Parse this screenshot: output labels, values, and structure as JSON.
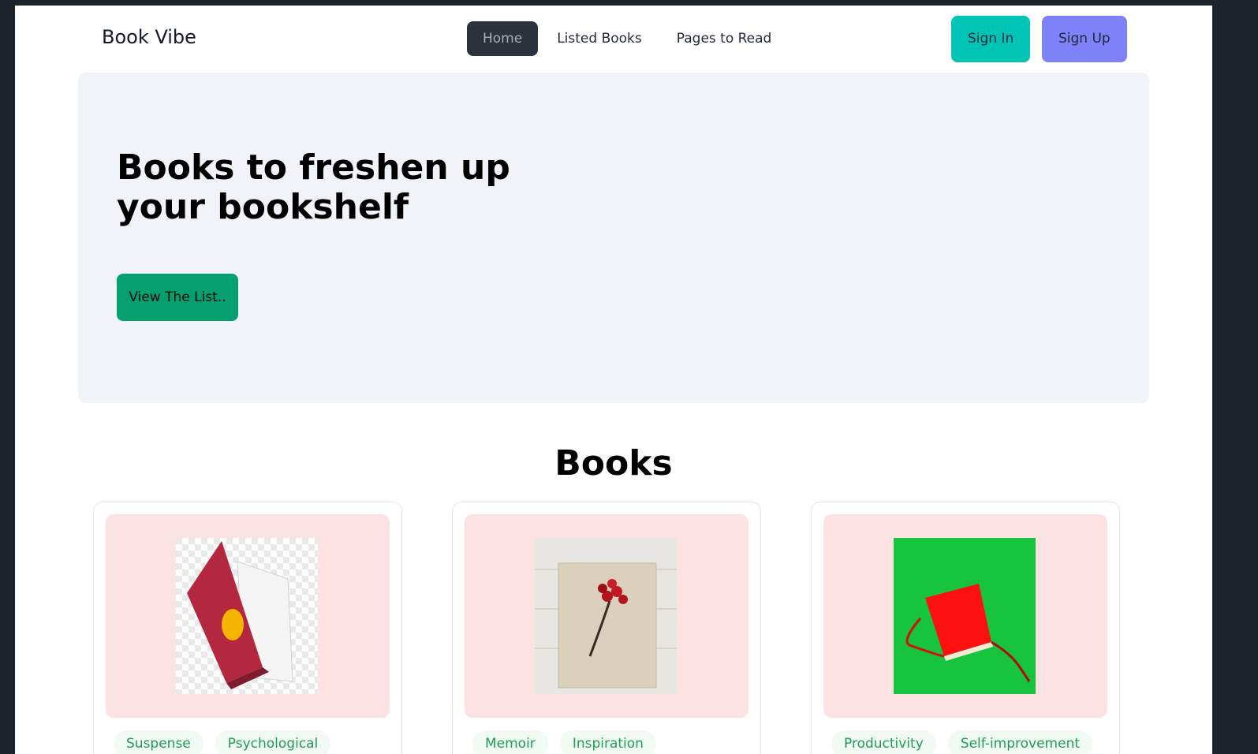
{
  "navbar": {
    "brand": "Book Vibe",
    "links": [
      {
        "label": "Home",
        "active": true
      },
      {
        "label": "Listed Books",
        "active": false
      },
      {
        "label": "Pages to Read",
        "active": false
      }
    ],
    "sign_in": "Sign In",
    "sign_up": "Sign Up"
  },
  "hero": {
    "title": "Books to freshen up your bookshelf",
    "button": "View The List.."
  },
  "books_section": {
    "title": "Books",
    "cards": [
      {
        "cover": "red-exercise-book-image",
        "tags": [
          "Suspense",
          "Psychological"
        ]
      },
      {
        "cover": "beige-book-with-berries-image",
        "tags": [
          "Memoir",
          "Inspiration"
        ]
      },
      {
        "cover": "red-notebook-on-green-image",
        "tags": [
          "Productivity",
          "Self-improvement"
        ]
      }
    ]
  },
  "colors": {
    "active_nav": "#2a323c",
    "sign_in": "#00c5b6",
    "sign_up": "#7d82f8",
    "hero_button": "#06a06e",
    "tag_text": "#1f9d55",
    "card_image_bg": "#fde2e4"
  }
}
